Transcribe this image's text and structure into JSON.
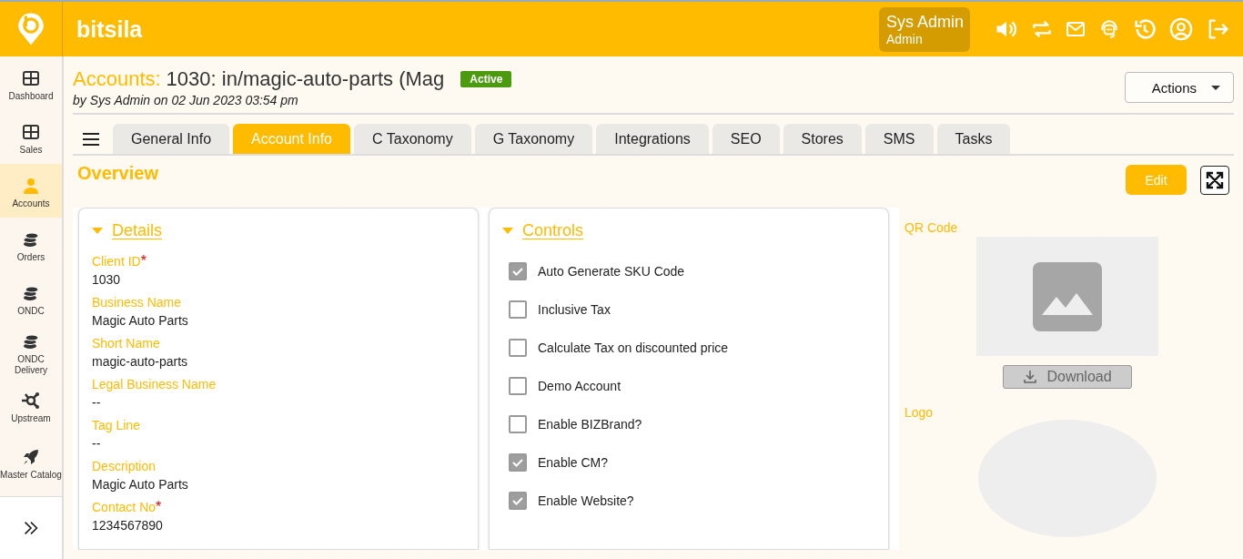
{
  "header": {
    "brand": "bitsila",
    "user": {
      "name": "Sys Admin",
      "role": "Admin"
    }
  },
  "sidebar": {
    "items": [
      {
        "label": "Dashboard",
        "kind": "grid",
        "selected": false
      },
      {
        "label": "Sales",
        "kind": "grid",
        "selected": false
      },
      {
        "label": "Accounts",
        "kind": "person",
        "selected": true
      },
      {
        "label": "Orders",
        "kind": "coins",
        "selected": false
      },
      {
        "label": "ONDC",
        "kind": "coins",
        "selected": false
      },
      {
        "label": "ONDC Delivery",
        "kind": "coins",
        "selected": false
      },
      {
        "label": "Upstream",
        "kind": "hub",
        "selected": false
      },
      {
        "label": "Master Catalog",
        "kind": "rocket",
        "selected": false
      }
    ]
  },
  "page": {
    "title_prefix": "Accounts:",
    "title": "1030: in/magic-auto-parts (Mag",
    "status": "Active",
    "byline": "by Sys Admin on 02 Jun 2023 03:54 pm",
    "actions_button": "Actions"
  },
  "tabs": [
    {
      "label": "General Info",
      "selected": false
    },
    {
      "label": "Account Info",
      "selected": true
    },
    {
      "label": "C Taxonomy",
      "selected": false
    },
    {
      "label": "G Taxonomy",
      "selected": false
    },
    {
      "label": "Integrations",
      "selected": false
    },
    {
      "label": "SEO",
      "selected": false
    },
    {
      "label": "Stores",
      "selected": false
    },
    {
      "label": "SMS",
      "selected": false
    },
    {
      "label": "Tasks",
      "selected": false
    }
  ],
  "overview": {
    "heading": "Overview",
    "edit_button": "Edit"
  },
  "details": {
    "heading": "Details",
    "expanded": true,
    "fields": [
      {
        "label": "Client ID",
        "required_mark": "*",
        "value": "1030"
      },
      {
        "label": "Business Name",
        "value": "Magic Auto Parts"
      },
      {
        "label": "Short Name",
        "value": "magic-auto-parts"
      },
      {
        "label": "Legal Business Name",
        "value": "--"
      },
      {
        "label": "Tag Line",
        "value": "--"
      },
      {
        "label": "Description",
        "value": "Magic Auto Parts"
      },
      {
        "label": "Contact No",
        "required_mark": "*",
        "value": "1234567890"
      }
    ]
  },
  "controls": {
    "heading": "Controls",
    "expanded": true,
    "items": [
      {
        "label": "Auto Generate SKU Code",
        "checked": true
      },
      {
        "label": "Inclusive Tax",
        "checked": false
      },
      {
        "label": "Calculate Tax on discounted price",
        "checked": false
      },
      {
        "label": "Demo Account",
        "checked": false
      },
      {
        "label": "Enable BIZBrand?",
        "checked": false
      },
      {
        "label": "Enable CM?",
        "checked": true
      },
      {
        "label": "Enable Website?",
        "checked": true
      }
    ]
  },
  "media": {
    "qr_label": "QR Code",
    "download_button": "Download",
    "logo_label": "Logo"
  }
}
